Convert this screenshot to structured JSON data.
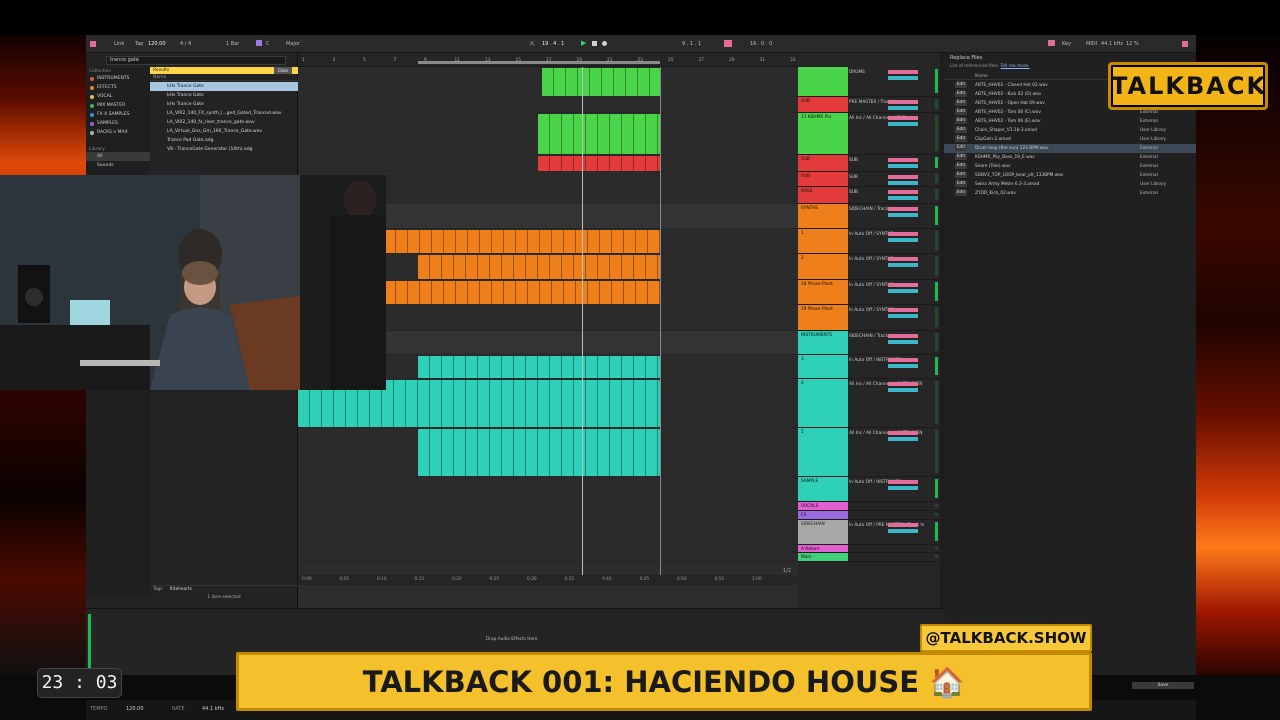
{
  "overlay": {
    "logo": "TALKBACK",
    "handle": "@TALKBACK.SHOW",
    "title": "TALKBACK 001: HACIENDO HOUSE 🏠",
    "timer": "23 : 03"
  },
  "controlbar": {
    "link": "Link",
    "tap": "Tap",
    "tempo": "120.00",
    "signature": "4 / 4",
    "quant": "1 Bar",
    "key": "C",
    "scale": "Major",
    "position": "19 . 4 . 1",
    "loop_start": "9 . 1 . 1",
    "loop_len": "16 . 0 . 0",
    "key_label": "Key",
    "midi_label": "MIDI",
    "samplerate": "44.1 kHz",
    "cpu": "12 %"
  },
  "browser": {
    "search": "trance gate",
    "collections_header": "Collection",
    "collections": [
      {
        "label": "INSTRUMENTS",
        "color": "#e0564a"
      },
      {
        "label": "EFFECTS",
        "color": "#e38a2c"
      },
      {
        "label": "VOCAL",
        "color": "#e6c43a"
      },
      {
        "label": "MIX MASTER",
        "color": "#4cae5a"
      },
      {
        "label": "FX X SAMPLES",
        "color": "#3f8fd6"
      },
      {
        "label": "SAMPLES",
        "color": "#9a62d4"
      },
      {
        "label": "RACKS n MAX",
        "color": "#b0b0b0"
      }
    ],
    "library_header": "Library",
    "library": [
      "All",
      "Sounds"
    ],
    "results_label": "Results",
    "clear_label": "Clear",
    "name_label": "Name",
    "results": [
      "kHs Trance Gate",
      "kHs Trance Gate",
      "kHs Trance Gate",
      "LA_VIR2_140_FX_synth_l...ged_Gated_Tranced.wav",
      "LA_VIR2_140_fx_riser_trance_gate.wav",
      "LA_Virtual_Gns_Gm_166_Trance_Gate.wav",
      "Trance Pad Gate.adg",
      "V8 - TranceGate Generator (16th).adg"
    ],
    "tags_label": "Tags",
    "tags_value": "Kitehearts",
    "selected_count": "1 item selected"
  },
  "arrangement": {
    "bars": [
      "1",
      "3",
      "5",
      "7",
      "9",
      "11",
      "13",
      "15",
      "17",
      "19",
      "21",
      "23",
      "25",
      "27",
      "29",
      "31",
      "33"
    ],
    "times": [
      "0:00",
      "0:05",
      "0:10",
      "0:15",
      "0:20",
      "0:25",
      "0:30",
      "0:35",
      "0:40",
      "0:45",
      "0:50",
      "0:55",
      "1:00"
    ],
    "page": "1/2"
  },
  "mixer": {
    "tracks": [
      {
        "name": "",
        "io": "DRUMS",
        "color": "#49d449",
        "h": 30
      },
      {
        "name": "SUB",
        "io": "PRE MASTER / Track In",
        "color": "#e33a3a",
        "h": 16
      },
      {
        "name": "11 KSHMR Pla",
        "io": "All Ins / All Channels / SUB",
        "color": "#49d449",
        "h": 42
      },
      {
        "name": "SUB",
        "io": "SUB",
        "color": "#e33a3a",
        "h": 17
      },
      {
        "name": "SUB",
        "io": "SUB",
        "color": "#e33a3a",
        "h": 15
      },
      {
        "name": "BASS",
        "io": "SUB",
        "color": "#e33a3a",
        "h": 17
      },
      {
        "name": "SYNTHS",
        "io": "SIDECHAIN / Track In",
        "color": "#ee7f1a",
        "h": 25
      },
      {
        "name": "1",
        "io": "In Auto Off / SYNTHS",
        "color": "#ee7f1a",
        "h": 25
      },
      {
        "name": "2",
        "io": "In Auto Off / SYNTHS",
        "color": "#ee7f1a",
        "h": 26
      },
      {
        "name": "18 Phase Plant",
        "io": "In Auto Off / SYNTHS",
        "color": "#ee7f1a",
        "h": 25
      },
      {
        "name": "19 Phase Plant",
        "io": "In Auto Off / SYNTHS",
        "color": "#ee7f1a",
        "h": 26
      },
      {
        "name": "INSTRUMENTS",
        "io": "SIDECHAIN / Track In",
        "color": "#2ed1b8",
        "h": 24
      },
      {
        "name": "3",
        "io": "In Auto Off / INSTRUMEN",
        "color": "#2ed1b8",
        "h": 24
      },
      {
        "name": "4",
        "io": "All Ins / All Channels / INSTRUMEN",
        "color": "#2ed1b8",
        "h": 49
      },
      {
        "name": "5",
        "io": "All Ins / All Channels / INSTRUMEN",
        "color": "#2ed1b8",
        "h": 49
      },
      {
        "name": "SAMPLE",
        "io": "In Auto Off / INSTRUMEN",
        "color": "#2ed1b8",
        "h": 25
      },
      {
        "name": "VOCALS",
        "io": "Track In",
        "color": "#e35fd0",
        "h": 9
      },
      {
        "name": "FX",
        "io": "Track In",
        "color": "#9a6ae0",
        "h": 9
      },
      {
        "name": "SIDECHAIN",
        "io": "In Auto Off / PRE MASTER / Track In",
        "color": "#a8a8a8",
        "h": 25
      },
      {
        "name": "A Return",
        "io": "",
        "color": "#e35fd0",
        "h": 8
      },
      {
        "name": "Main",
        "io": "1/2",
        "color": "#3fd07a",
        "h": 9
      }
    ]
  },
  "references": {
    "title": "Replace Files",
    "subtitle": "List of referenced files.",
    "tell_more": "Tell me more.",
    "col_name": "Name",
    "edit_label": "Edit",
    "save_label": "Save",
    "files": [
      {
        "name": "ABTS_HHV02 - Closed Hat 02.wav",
        "loc": "External"
      },
      {
        "name": "ABTS_HHV02 - Kick 02 (D).wav",
        "loc": "External"
      },
      {
        "name": "ABTS_HHV02 - Open Hat 09.wav",
        "loc": "External"
      },
      {
        "name": "ABTS_HHV02 - Tom 06 (C).wav",
        "loc": "External"
      },
      {
        "name": "ABTS_HHV02 - Tom 06 (E).wav",
        "loc": "External"
      },
      {
        "name": "Chain_Shaper_V3.1b-3.amxd",
        "loc": "User Library"
      },
      {
        "name": "ClipGain-2.amxd",
        "loc": "User Library"
      },
      {
        "name": "Drum loop (the sun) 123 BPM.wav",
        "loc": "External"
      },
      {
        "name": "KSHMR_Pky_Bass_19_E.wav",
        "loc": "External"
      },
      {
        "name": "Snare (Tele).wav",
        "loc": "External"
      },
      {
        "name": "SOBV3_TOP_LOOP_bear_plt_133BPM.wav",
        "loc": "External"
      },
      {
        "name": "Swiss Army Meter 6.3-3.amxd",
        "loc": "User Library"
      },
      {
        "name": "ZYDD_Kick_02.wav",
        "loc": "External"
      }
    ]
  },
  "detail": {
    "drop": "Drop Audio Effects Here"
  },
  "status": {
    "tempo_label": "TEMPO",
    "tempo": "120.00",
    "rate_label": "RATE",
    "rate": "44.1 kHz"
  }
}
